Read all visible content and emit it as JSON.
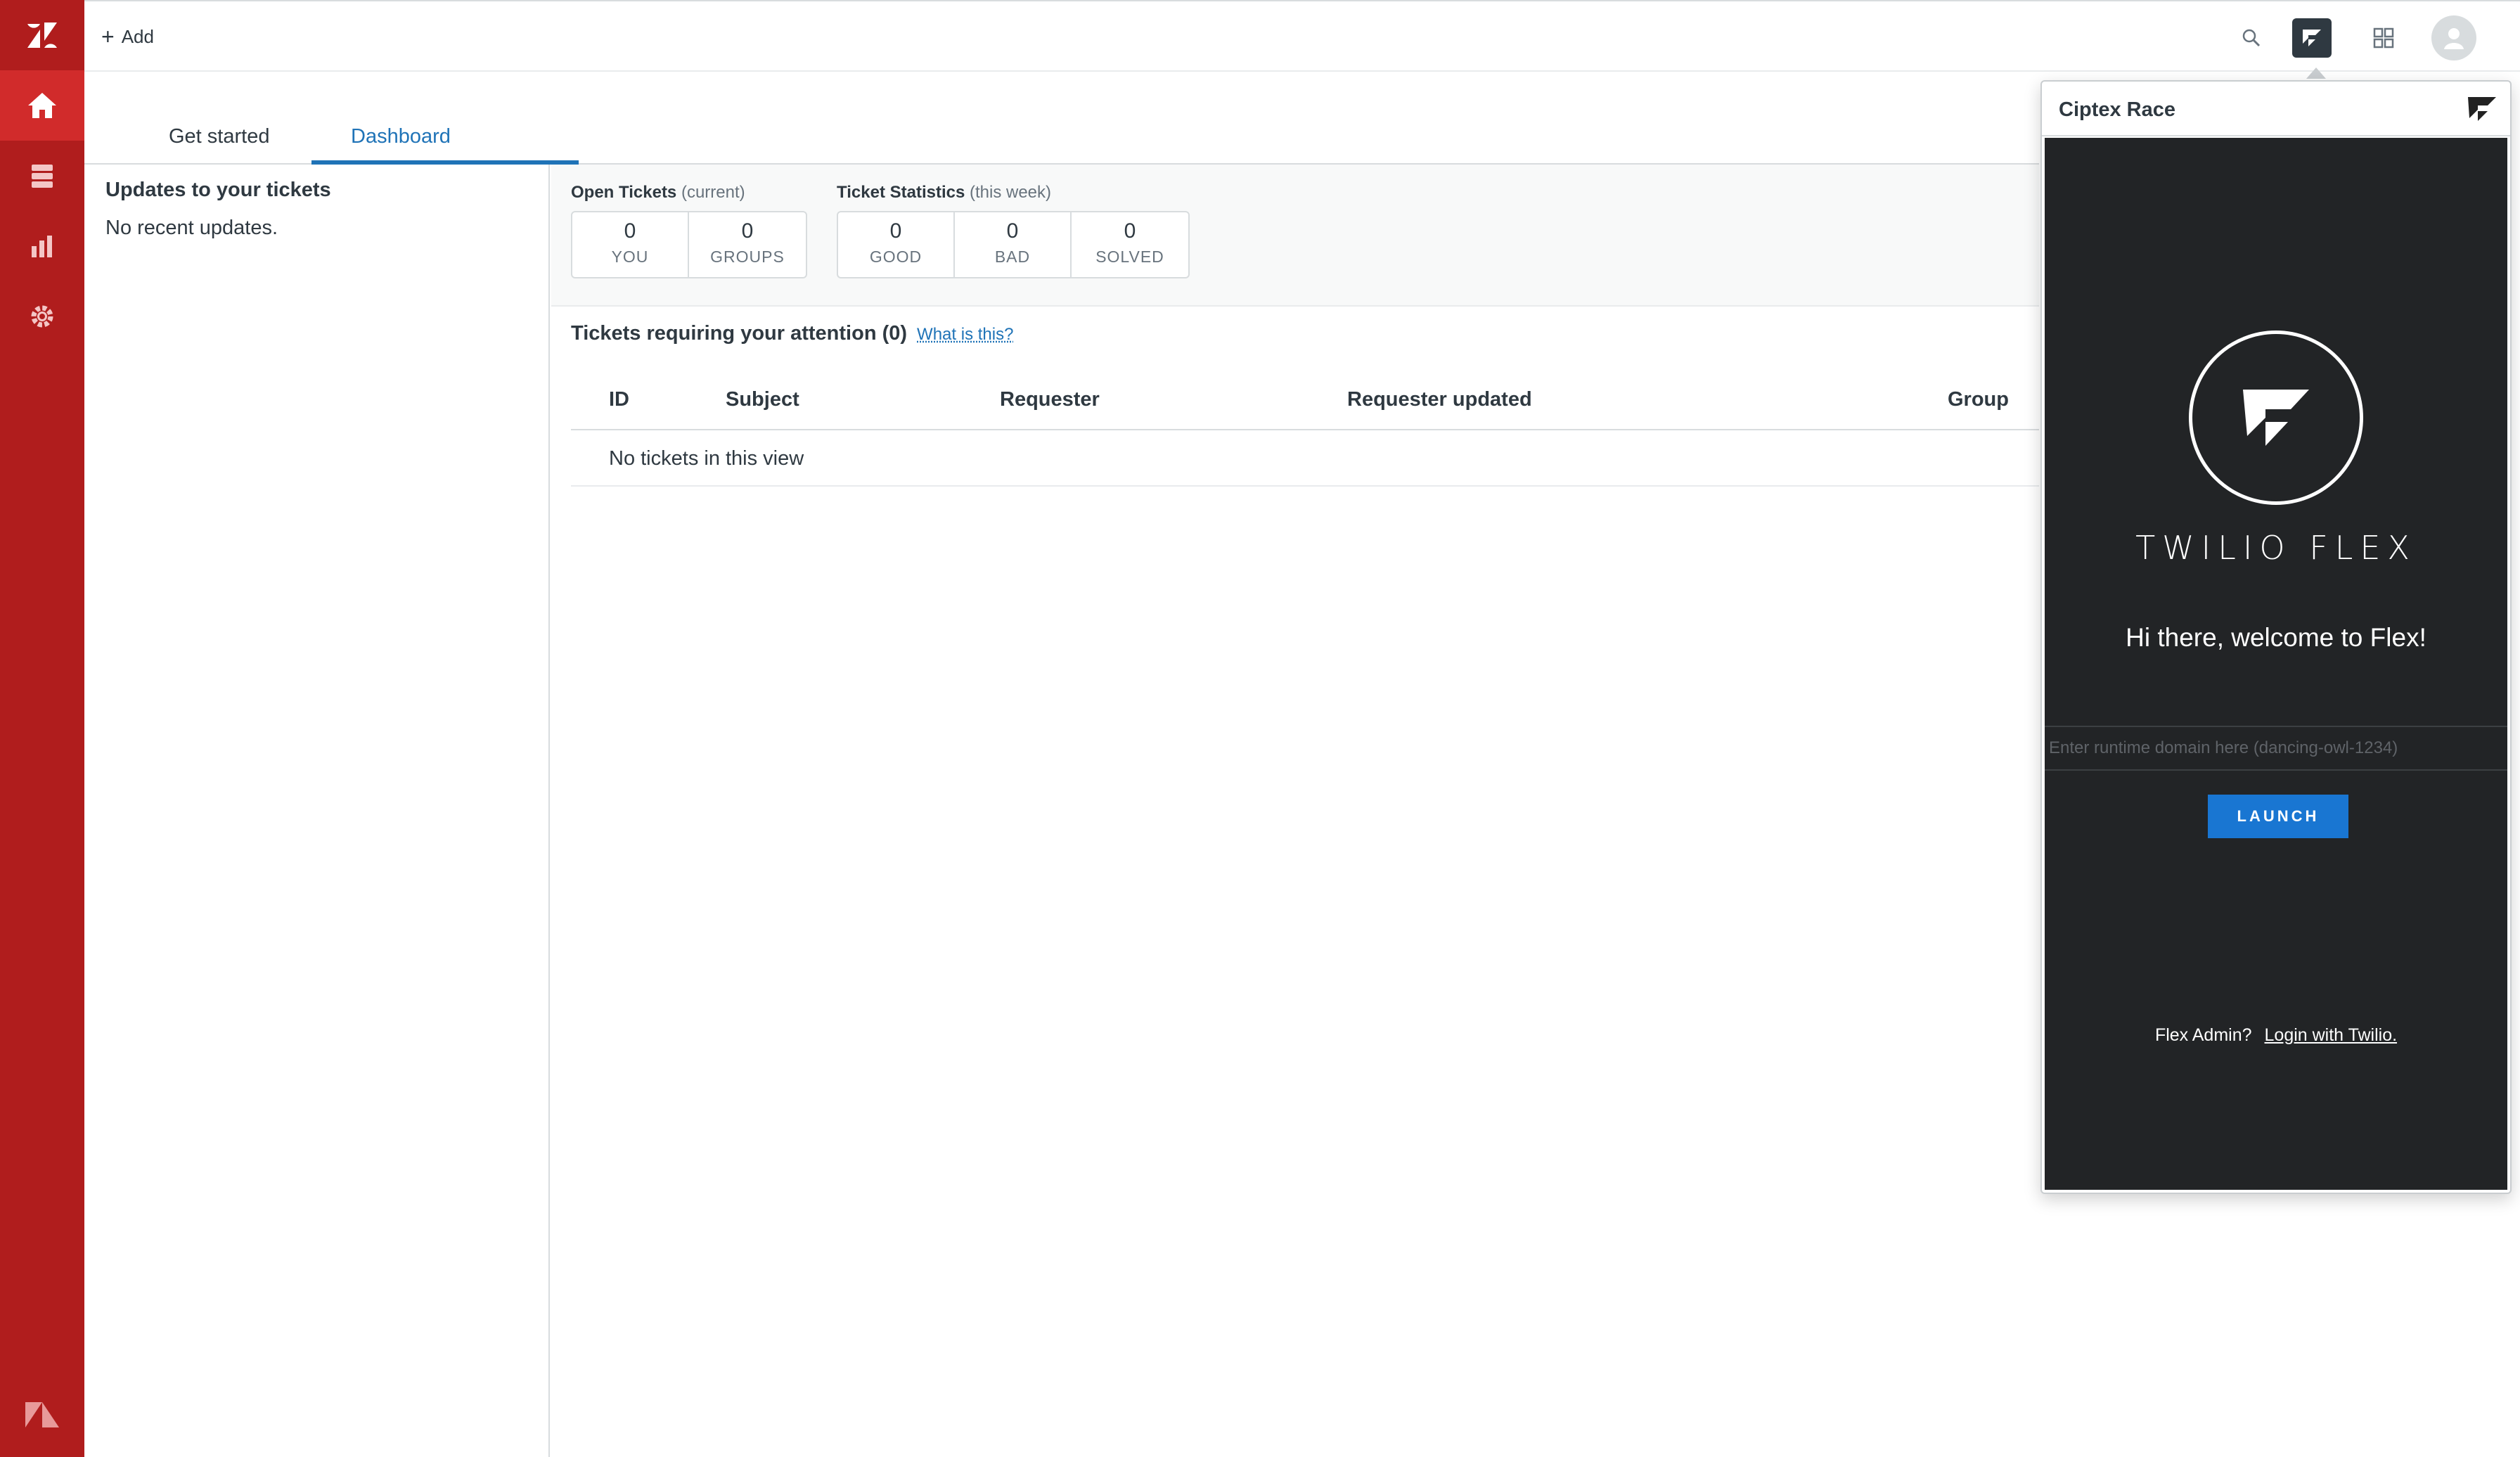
{
  "rail": {
    "items": [
      {
        "name": "home-icon",
        "active": true
      },
      {
        "name": "views-icon",
        "active": false
      },
      {
        "name": "reporting-icon",
        "active": false
      },
      {
        "name": "admin-gear-icon",
        "active": false
      }
    ],
    "brand_color": "#b01d1d",
    "active_color": "#d12b2b"
  },
  "topbar": {
    "add_label": "Add",
    "icons": [
      "search-icon",
      "twilio-flex-icon",
      "apps-grid-icon",
      "user-avatar-icon"
    ]
  },
  "tabs": [
    {
      "label": "Get started",
      "active": false
    },
    {
      "label": "Dashboard",
      "active": true
    }
  ],
  "updates": {
    "title": "Updates to your tickets",
    "empty_text": "No recent updates."
  },
  "open_tickets": {
    "label": "Open Tickets",
    "qualifier": "(current)",
    "boxes": [
      {
        "value": "0",
        "caption": "YOU"
      },
      {
        "value": "0",
        "caption": "GROUPS"
      }
    ]
  },
  "ticket_stats": {
    "label": "Ticket Statistics",
    "qualifier": "(this week)",
    "boxes": [
      {
        "value": "0",
        "caption": "GOOD"
      },
      {
        "value": "0",
        "caption": "BAD"
      },
      {
        "value": "0",
        "caption": "SOLVED"
      }
    ]
  },
  "attention": {
    "title": "Tickets requiring your attention (0)",
    "help_link": "What is this?",
    "columns": [
      "ID",
      "Subject",
      "Requester",
      "Requester updated",
      "Group"
    ],
    "empty_text": "No tickets in this view"
  },
  "flex_popover": {
    "title": "Ciptex Race",
    "wordmark": "TWILIO FLEX",
    "welcome": "Hi there, welcome to Flex!",
    "domain_placeholder": "Enter runtime domain here (dancing-owl-1234)",
    "domain_value": "",
    "launch_label": "LAUNCH",
    "admin_prompt": "Flex Admin?",
    "login_link": "Login with Twilio.",
    "accent_color": "#1976d2",
    "panel_color": "#222426"
  }
}
